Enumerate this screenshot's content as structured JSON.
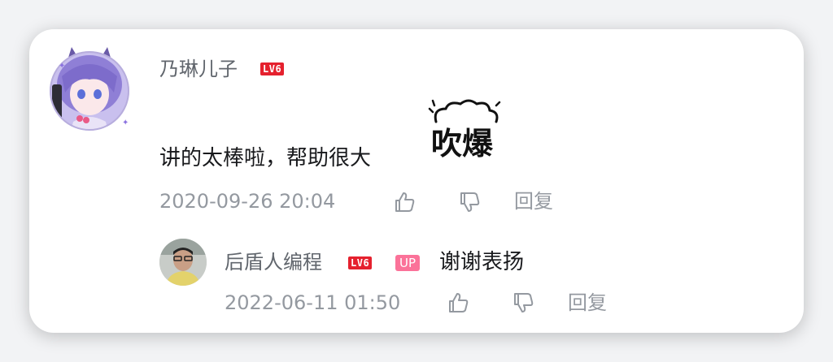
{
  "comment": {
    "username": "乃琳儿子",
    "level": "LV6",
    "text": "讲的太棒啦，帮助很大",
    "sticker": "吹爆",
    "timestamp": "2020-09-26 20:04",
    "reply_label": "回复"
  },
  "reply": {
    "username": "后盾人编程",
    "level": "LV6",
    "up_badge": "UP",
    "text": "谢谢表扬",
    "timestamp": "2022-06-11 01:50",
    "reply_label": "回复"
  },
  "icons": {
    "like": "thumb-up-icon",
    "dislike": "thumb-down-icon"
  },
  "colors": {
    "level_badge": "#e5212e",
    "up_badge": "#fb7299",
    "username": "#61666d",
    "text": "#18191c",
    "meta": "#9499a0"
  }
}
